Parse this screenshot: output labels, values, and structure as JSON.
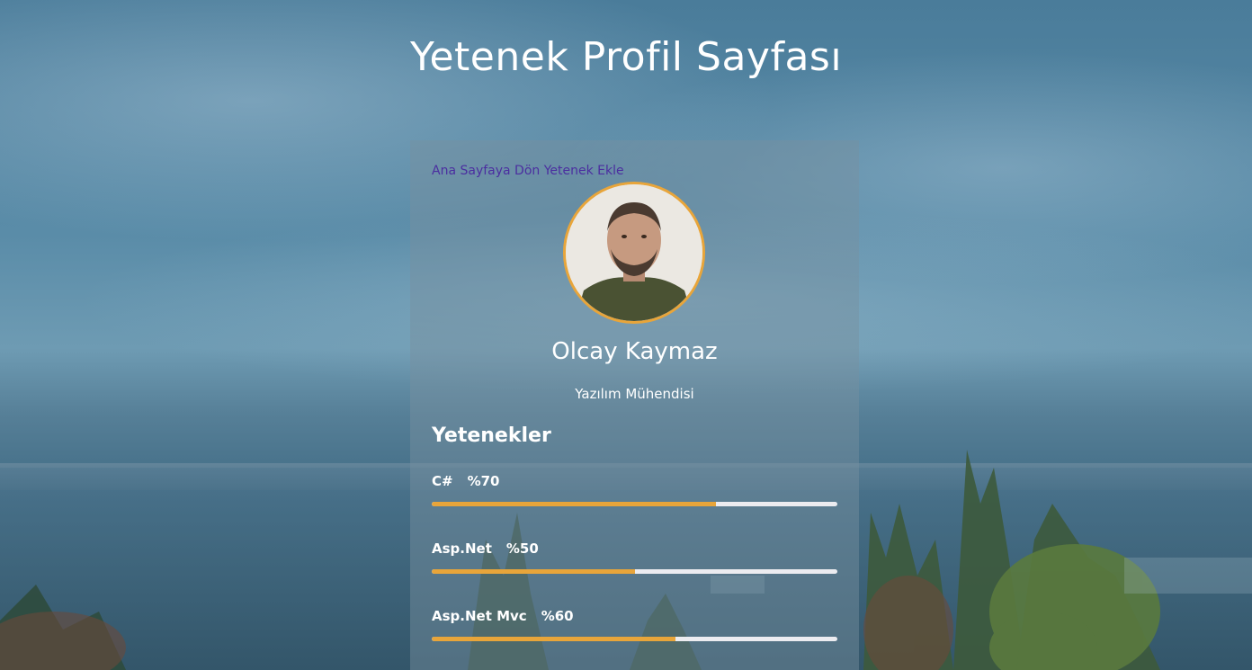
{
  "page": {
    "title": "Yetenek Profil Sayfası"
  },
  "nav": {
    "home_link": "Ana Sayfaya Dön",
    "add_skill_link": "Yetenek Ekle"
  },
  "profile": {
    "name": "Olcay Kaymaz",
    "job_title": "Yazılım Mühendisi"
  },
  "skills": {
    "heading": "Yetenekler",
    "items": [
      {
        "name": "C#",
        "percent_label": "%70",
        "level": 0.7
      },
      {
        "name": "Asp.Net",
        "percent_label": "%50",
        "level": 0.5
      },
      {
        "name": "Asp.Net Mvc",
        "percent_label": "%60",
        "level": 0.6
      }
    ]
  },
  "colors": {
    "accent": "#e8a53a",
    "link": "#4b2ea0",
    "bar_track": "#ececf0"
  }
}
